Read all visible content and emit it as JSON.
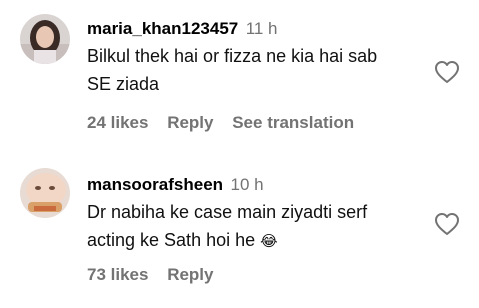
{
  "comments": [
    {
      "username": "maria_khan123457",
      "time": "11 h",
      "text_lines": [
        "Bilkul thek hai or fizza ne kia hai sab",
        "SE ziada"
      ],
      "emoji": "",
      "likes": "24 likes",
      "reply": "Reply",
      "see_translation": "See translation"
    },
    {
      "username": "mansoorafsheen",
      "time": "10 h",
      "text_lines": [
        "Dr nabiha ke case main ziyadti serf",
        "acting ke Sath hoi he"
      ],
      "emoji": "😂",
      "likes": "73 likes",
      "reply": "Reply"
    }
  ],
  "icons": {
    "like": "heart-outline-icon"
  },
  "colors": {
    "muted": "#737373",
    "text": "#000000",
    "background": "#ffffff"
  }
}
